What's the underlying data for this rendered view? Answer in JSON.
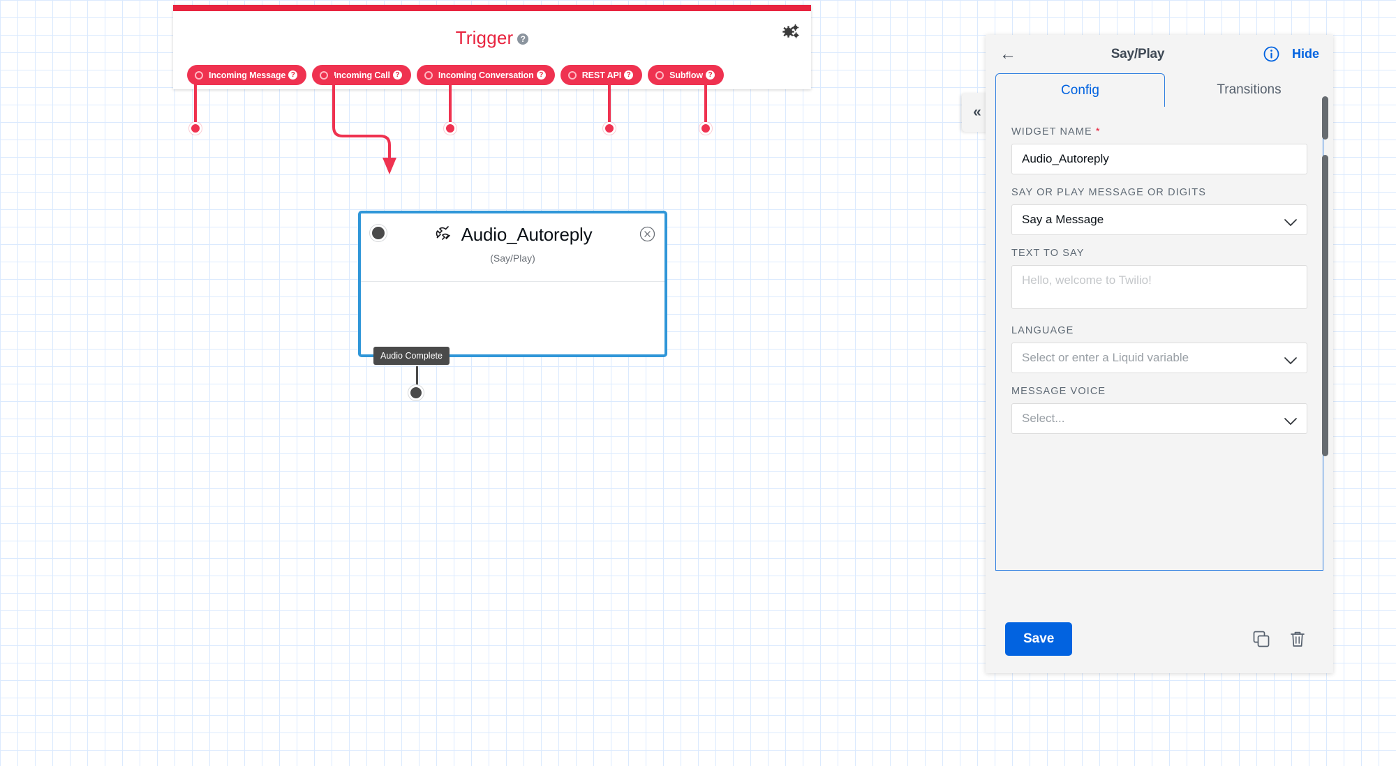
{
  "canvas": {
    "trigger": {
      "title": "Trigger",
      "help_glyph": "?",
      "gear_icon": "gears-icon",
      "pills": [
        {
          "label": "Incoming Message"
        },
        {
          "label": "Incoming Call"
        },
        {
          "label": "Incoming Conversation"
        },
        {
          "label": "REST API"
        },
        {
          "label": "Subflow"
        }
      ],
      "accent_color": "#ef3250"
    },
    "widget": {
      "title": "Audio_Autoreply",
      "subtitle": "(Say/Play)",
      "icon": "phone-handset-icon",
      "close_glyph": "×",
      "border_color": "#2f96d8",
      "transition_label": "Audio Complete"
    }
  },
  "inspector": {
    "header": {
      "back_glyph": "←",
      "title": "Say/Play",
      "info_glyph": "i",
      "hide_label": "Hide"
    },
    "tabs": [
      {
        "label": "Config",
        "active": true
      },
      {
        "label": "Transitions",
        "active": false
      }
    ],
    "fields": {
      "widget_name": {
        "label": "WIDGET NAME",
        "required_marker": "*",
        "value": "Audio_Autoreply",
        "placeholder": ""
      },
      "say_or_play": {
        "label": "SAY OR PLAY MESSAGE OR DIGITS",
        "value": "Say a Message"
      },
      "text_to_say": {
        "label": "TEXT TO SAY",
        "value": "",
        "placeholder": "Hello, welcome to Twilio!"
      },
      "language": {
        "label": "LANGUAGE",
        "value": "",
        "placeholder": "Select or enter a Liquid variable"
      },
      "message_voice": {
        "label": "MESSAGE VOICE",
        "value": "",
        "placeholder": "Select..."
      }
    },
    "footer": {
      "save_label": "Save",
      "duplicate_icon": "duplicate-icon",
      "delete_icon": "trash-icon"
    },
    "collapse_glyph": "«",
    "accent_color": "#0263e0"
  }
}
